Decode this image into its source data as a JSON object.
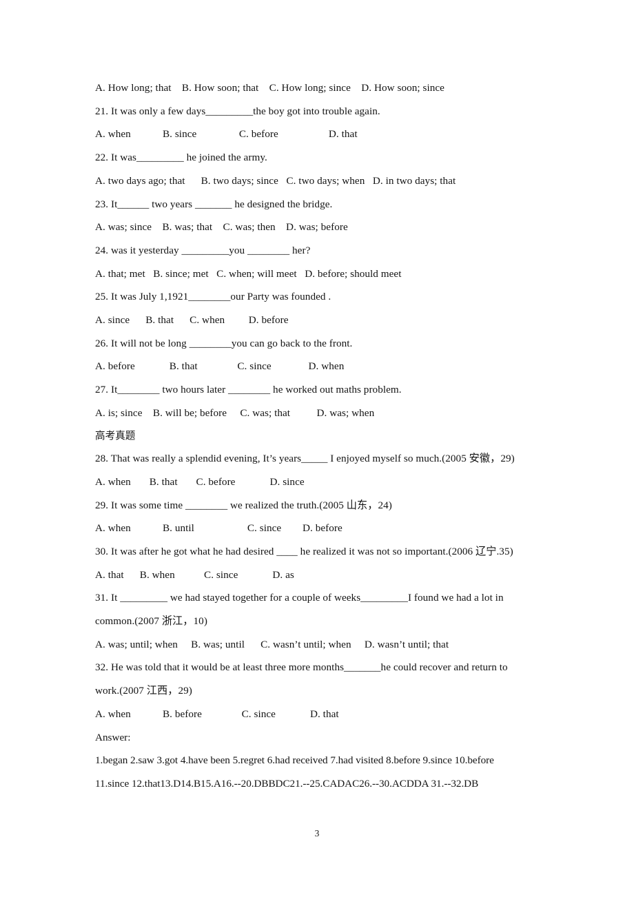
{
  "document": {
    "type": "grammar-worksheet",
    "page_number": "3",
    "section_heading_cjk": "高考真题"
  },
  "lines": [
    {
      "id": "l0_opts",
      "kind": "options",
      "text": "A. How long; that    B. How soon; that    C. How long; since    D. How soon; since"
    },
    {
      "id": "q21_stem",
      "kind": "stem",
      "text": "21. It was only a few days_________the boy got into trouble again."
    },
    {
      "id": "q21_opts",
      "kind": "options",
      "text": "A. when            B. since                C. before                   D. that"
    },
    {
      "id": "q22_stem",
      "kind": "stem",
      "text": "22. It was_________ he joined the army."
    },
    {
      "id": "q22_opts",
      "kind": "options",
      "text": "A. two days ago; that      B. two days; since   C. two days; when   D. in two days; that"
    },
    {
      "id": "q23_stem",
      "kind": "stem",
      "text": "23. It______ two years _______ he designed the bridge."
    },
    {
      "id": "q23_opts",
      "kind": "options",
      "text": "A. was; since    B. was; that    C. was; then    D. was; before"
    },
    {
      "id": "q24_stem",
      "kind": "stem",
      "text": "24. was it yesterday _________you ________ her?"
    },
    {
      "id": "q24_opts",
      "kind": "options",
      "text": "A. that; met   B. since; met   C. when; will meet   D. before; should meet"
    },
    {
      "id": "q25_stem",
      "kind": "stem",
      "text": "25. It was July 1,1921________our Party was founded ."
    },
    {
      "id": "q25_opts",
      "kind": "options",
      "text": "A. since      B. that      C. when         D. before"
    },
    {
      "id": "q26_stem",
      "kind": "stem",
      "text": "26. It will not be long ________you can go back to the front."
    },
    {
      "id": "q26_opts",
      "kind": "options",
      "text": "A. before             B. that               C. since              D. when"
    },
    {
      "id": "q27_stem",
      "kind": "stem",
      "text": "27. It________ two hours later ________ he worked out maths problem."
    },
    {
      "id": "q27_opts",
      "kind": "options",
      "text": "A. is; since    B. will be; before     C. was; that          D. was; when"
    }
  ],
  "gaokao": {
    "heading": "高考真题",
    "lines": [
      {
        "id": "q28_stem",
        "kind": "stem",
        "text": "28. That was really a splendid evening, It’s years_____ I enjoyed myself so much.(2005 安徽，29)"
      },
      {
        "id": "q28_opts",
        "kind": "options",
        "text": "A. when       B. that       C. before             D. since"
      },
      {
        "id": "q29_stem",
        "kind": "stem",
        "text": "29. It was some time ________ we realized the truth.(2005 山东，24)"
      },
      {
        "id": "q29_opts",
        "kind": "options",
        "text": "A. when            B. until                    C. since        D. before"
      },
      {
        "id": "q30_stem",
        "kind": "stem",
        "text": "30. It was after he got what he had desired ____ he realized it was not so important.(2006 辽宁.35)"
      },
      {
        "id": "q30_opts",
        "kind": "options",
        "text": "A. that      B. when           C. since             D. as"
      },
      {
        "id": "q31_stem",
        "kind": "stem",
        "text": "31. It _________ we had stayed together for a couple of weeks_________I found we had a lot in"
      },
      {
        "id": "q31_cont",
        "kind": "continuation",
        "text": "common.(2007 浙江，10)"
      },
      {
        "id": "q31_opts",
        "kind": "options",
        "text": "A. was; until; when     B. was; until      C. wasn’t until; when     D. wasn’t until; that"
      },
      {
        "id": "q32_stem",
        "kind": "stem",
        "text": "32. He was told that it would be at least three more months_______he could recover and return to"
      },
      {
        "id": "q32_cont",
        "kind": "continuation",
        "text": "work.(2007 江西，29)"
      },
      {
        "id": "q32_opts",
        "kind": "options",
        "text": "A. when            B. before               C. since             D. that"
      }
    ]
  },
  "answers": {
    "label": "Answer:",
    "line1": "1.began 2.saw 3.got 4.have been 5.regret 6.had received 7.had visited 8.before 9.since 10.before",
    "line2": "11.since 12.that13.D14.B15.A16.--20.DBBDC21.--25.CADAC26.--30.ACDDA 31.--32.DB"
  },
  "footer": {
    "page_number": "3"
  }
}
